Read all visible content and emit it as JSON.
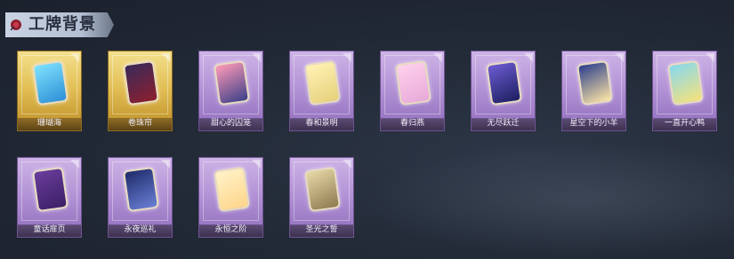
{
  "header": {
    "title": "工牌背景",
    "emblem_icon": "rose-emblem-icon"
  },
  "cards": [
    {
      "label": "珊瑚海",
      "rarity": "gold",
      "swatch": [
        "#7fe3ff",
        "#2e8fd6"
      ]
    },
    {
      "label": "卷珠帘",
      "rarity": "gold",
      "swatch": [
        "#3a2a5a",
        "#8c1f2e"
      ]
    },
    {
      "label": "甜心的囚笼",
      "rarity": "purple",
      "swatch": [
        "#ff9ab8",
        "#3c3f88"
      ]
    },
    {
      "label": "春和景明",
      "rarity": "purple",
      "swatch": [
        "#fff2b5",
        "#e6d07a"
      ]
    },
    {
      "label": "春归燕",
      "rarity": "purple",
      "swatch": [
        "#ffd2ec",
        "#e7a8d9"
      ]
    },
    {
      "label": "无尽跃迁",
      "rarity": "purple",
      "swatch": [
        "#6d5bd3",
        "#1c1f5f"
      ]
    },
    {
      "label": "星空下的小羊",
      "rarity": "purple",
      "swatch": [
        "#2b3e8c",
        "#ffe7a6"
      ]
    },
    {
      "label": "一直开心鸭",
      "rarity": "purple",
      "swatch": [
        "#86d8ef",
        "#f7e27a"
      ]
    },
    {
      "label": "童话扉页",
      "rarity": "purple",
      "swatch": [
        "#6a3d9c",
        "#3c1f66"
      ]
    },
    {
      "label": "永夜巡礼",
      "rarity": "purple",
      "swatch": [
        "#1f2c6a",
        "#6a7fd6"
      ]
    },
    {
      "label": "永恒之阶",
      "rarity": "purple",
      "swatch": [
        "#fff3c8",
        "#ffd48a"
      ]
    },
    {
      "label": "圣光之誓",
      "rarity": "purple",
      "swatch": [
        "#e8d9a8",
        "#8d7a4f"
      ]
    }
  ]
}
